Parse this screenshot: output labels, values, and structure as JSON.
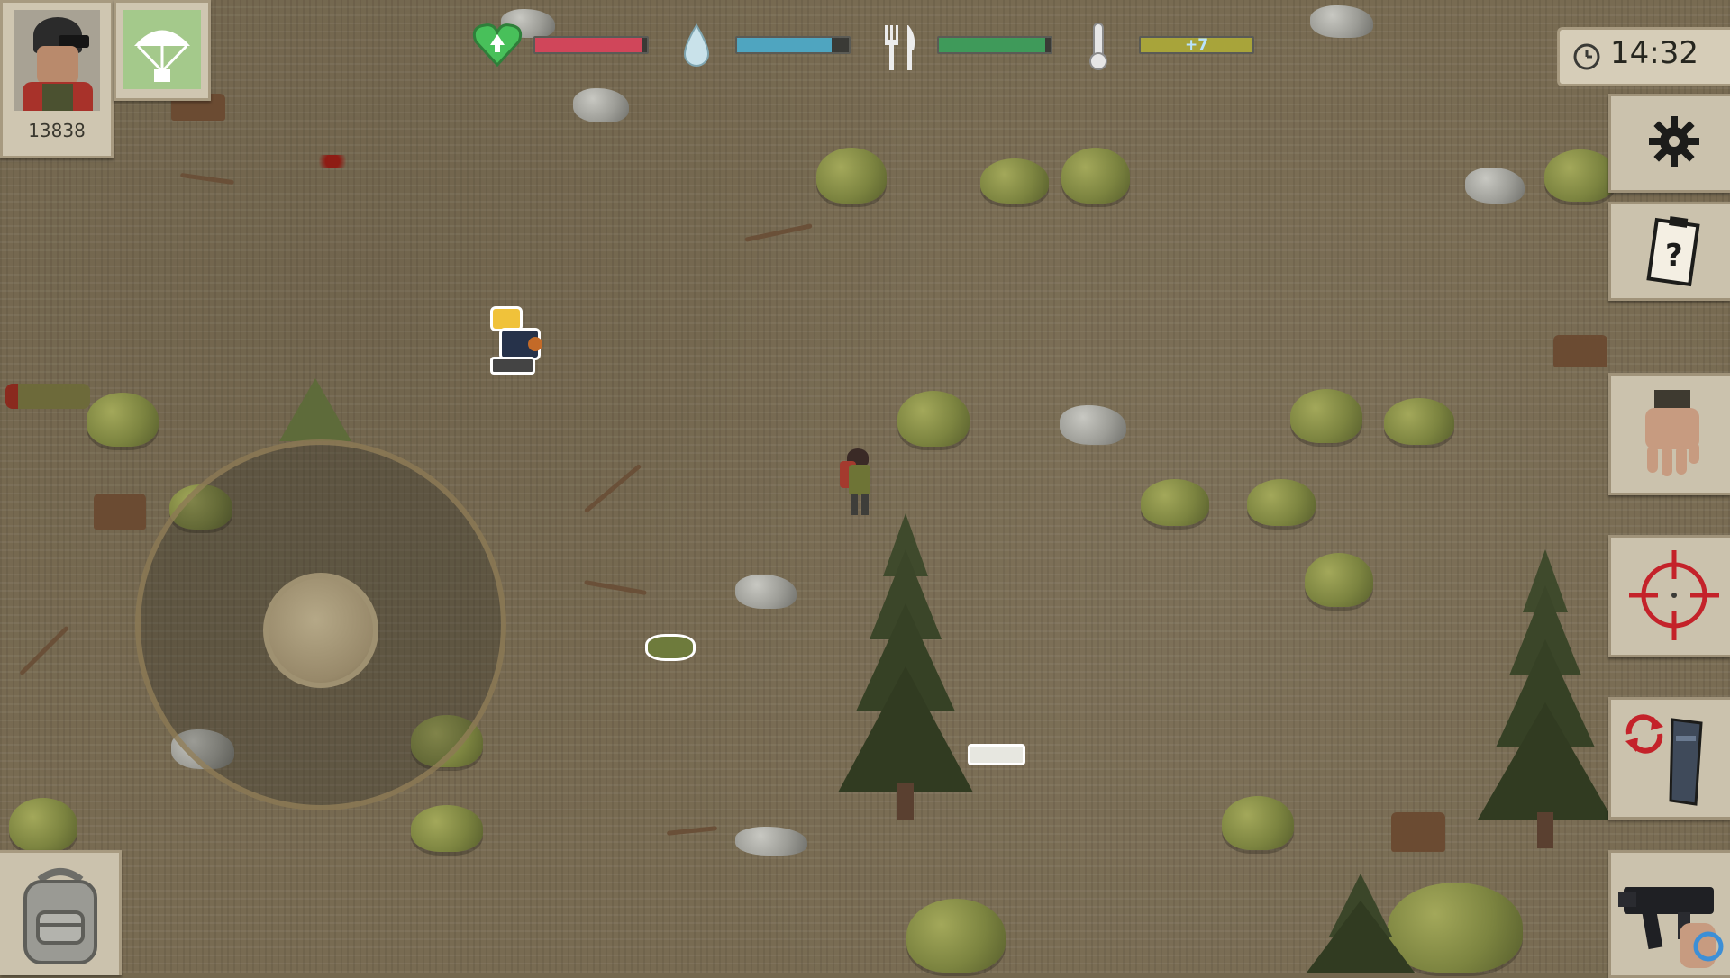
{
  "player": {
    "score": "13838",
    "portrait_icon": "soldier-portrait-icon",
    "airdrop_icon": "parachute-icon"
  },
  "stats": {
    "health_fill": 0.95,
    "water_fill": 0.85,
    "food_fill": 0.95,
    "temperature_label": "+7",
    "colors": {
      "health": "#d0465a",
      "water": "#4fa5c0",
      "food": "#3f9a5a",
      "temperature": "#a8a43a"
    }
  },
  "clock": {
    "time": "14:32"
  },
  "side_buttons": {
    "settings": "gear-icon",
    "quests": "quest-note-icon",
    "melee": "fist-icon",
    "aim": "crosshair-icon",
    "reload": "reload-icon",
    "weapon": "rifle-icon"
  },
  "inventory": {
    "icon": "backpack-icon"
  }
}
